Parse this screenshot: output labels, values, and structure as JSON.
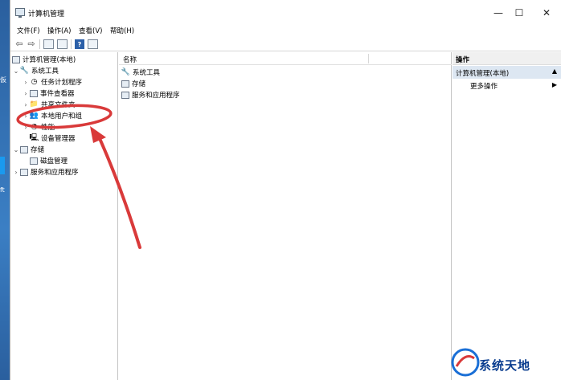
{
  "desktop": {
    "glyphs": [
      "仮",
      "ft"
    ]
  },
  "window": {
    "title": "计算机管理",
    "controls": {
      "minimize": "—",
      "maximize": "☐",
      "close": "✕"
    }
  },
  "menu": [
    "文件(F)",
    "操作(A)",
    "查看(V)",
    "帮助(H)"
  ],
  "toolbar": {
    "help": "?"
  },
  "tree": {
    "root": "计算机管理(本地)",
    "items": [
      {
        "label": "系统工具",
        "depth": 1,
        "expanded": true
      },
      {
        "label": "任务计划程序",
        "depth": 2
      },
      {
        "label": "事件查看器",
        "depth": 2
      },
      {
        "label": "共享文件夹",
        "depth": 2
      },
      {
        "label": "本地用户和组",
        "depth": 2
      },
      {
        "label": "性能",
        "depth": 2
      },
      {
        "label": "设备管理器",
        "depth": 2
      },
      {
        "label": "存储",
        "depth": 1,
        "expanded": true
      },
      {
        "label": "磁盘管理",
        "depth": 2
      },
      {
        "label": "服务和应用程序",
        "depth": 1
      }
    ]
  },
  "list": {
    "column": "名称",
    "rows": [
      "系统工具",
      "存储",
      "服务和应用程序"
    ]
  },
  "actions": {
    "header": "操作",
    "section": "计算机管理(本地)",
    "item": "更多操作"
  },
  "watermark": {
    "text": "系统天地"
  },
  "colors": {
    "annotation": "#d93a3a",
    "selection": "#dde7f2",
    "accent": "#2b5fa8"
  }
}
